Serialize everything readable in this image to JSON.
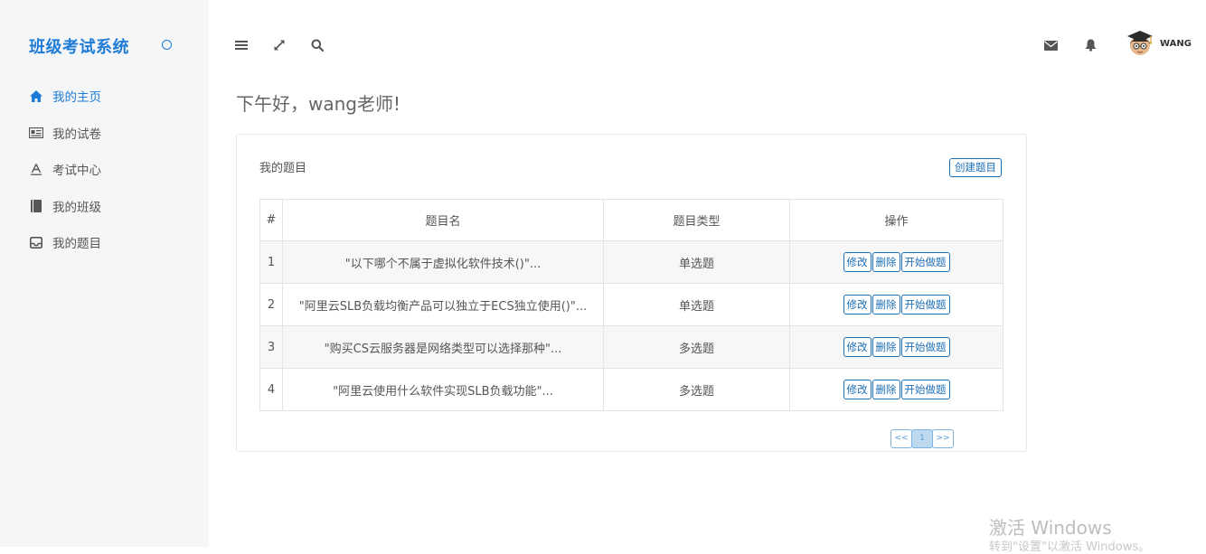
{
  "app": {
    "brand": "班级考试系统"
  },
  "sidebar": {
    "items": [
      {
        "label": "我的主页",
        "icon": "home-icon",
        "active": true
      },
      {
        "label": "我的试卷",
        "icon": "newspaper-icon",
        "active": false
      },
      {
        "label": "考试中心",
        "icon": "font-icon",
        "active": false
      },
      {
        "label": "我的班级",
        "icon": "book-icon",
        "active": false
      },
      {
        "label": "我的题目",
        "icon": "inbox-icon",
        "active": false
      }
    ]
  },
  "header": {
    "username": "WANG"
  },
  "main": {
    "greeting": "下午好，wang老师!",
    "panel": {
      "title": "我的题目",
      "create_label": "创建题目",
      "columns": [
        "#",
        "题目名",
        "题目类型",
        "操作"
      ],
      "rows": [
        {
          "num": "1",
          "name": "\"以下哪个不属于虚拟化软件技术()\"...",
          "type": "单选题"
        },
        {
          "num": "2",
          "name": "\"阿里云SLB负载均衡产品可以独立于ECS独立使用()\"...",
          "type": "单选题"
        },
        {
          "num": "3",
          "name": "\"购买CS云服务器是网络类型可以选择那种\"...",
          "type": "多选题"
        },
        {
          "num": "4",
          "name": "\"阿里云使用什么软件实现SLB负载功能\"...",
          "type": "多选题"
        }
      ],
      "actions": {
        "edit": "修改",
        "delete": "删除",
        "start": "开始做题"
      },
      "pagination": {
        "prev": "<<",
        "current": "1",
        "next": ">>"
      }
    }
  },
  "watermark": {
    "line1": "激活 Windows",
    "line2": "转到\"设置\"以激活 Windows。"
  },
  "colors": {
    "accent": "#1e7cd6",
    "sidebar_bg": "#f5f6f8",
    "button_border": "#1e6fb8"
  }
}
